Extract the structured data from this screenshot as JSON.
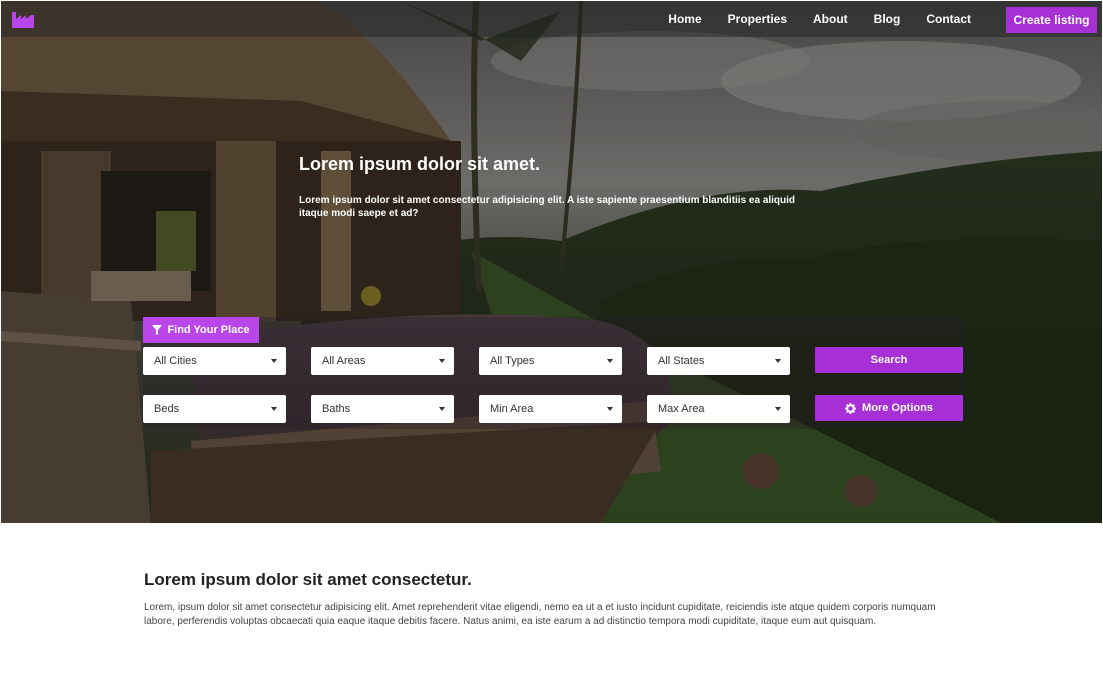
{
  "colors": {
    "accent": "#a62fd6",
    "accent_light": "#b846e8",
    "nav_bg": "#1e1e1e"
  },
  "header": {
    "logo_icon": "factory-icon",
    "nav": [
      "Home",
      "Properties",
      "About",
      "Blog",
      "Contact"
    ],
    "create_label": "Create listing"
  },
  "hero": {
    "title": "Lorem ipsum dolor sit amet.",
    "subtitle": "Lorem ipsum dolor sit amet consectetur adipisicing elit. A iste sapiente praesentium blanditiis ea aliquid itaque modi saepe et ad?"
  },
  "search": {
    "find_label": "Find Your Place",
    "find_icon": "filter-icon",
    "row1": [
      "All Cities",
      "All Areas",
      "All Types",
      "All States"
    ],
    "row2": [
      "Beds",
      "Baths",
      "Min Area",
      "Max Area"
    ],
    "search_label": "Search",
    "more_label": "More Options",
    "more_icon": "gear-icon"
  },
  "content": {
    "title": "Lorem ipsum dolor sit amet consectetur.",
    "text": "Lorem, ipsum dolor sit amet consectetur adipisicing elit. Amet reprehenderit vitae eligendi, nemo ea ut a et iusto incidunt cupiditate, reiciendis iste atque quidem corporis numquam labore, perferendis voluptas obcaecati quia eaque itaque debitis facere. Natus animi, ea iste earum a ad distinctio tempora modi cupiditate, itaque eum aut quisquam."
  }
}
